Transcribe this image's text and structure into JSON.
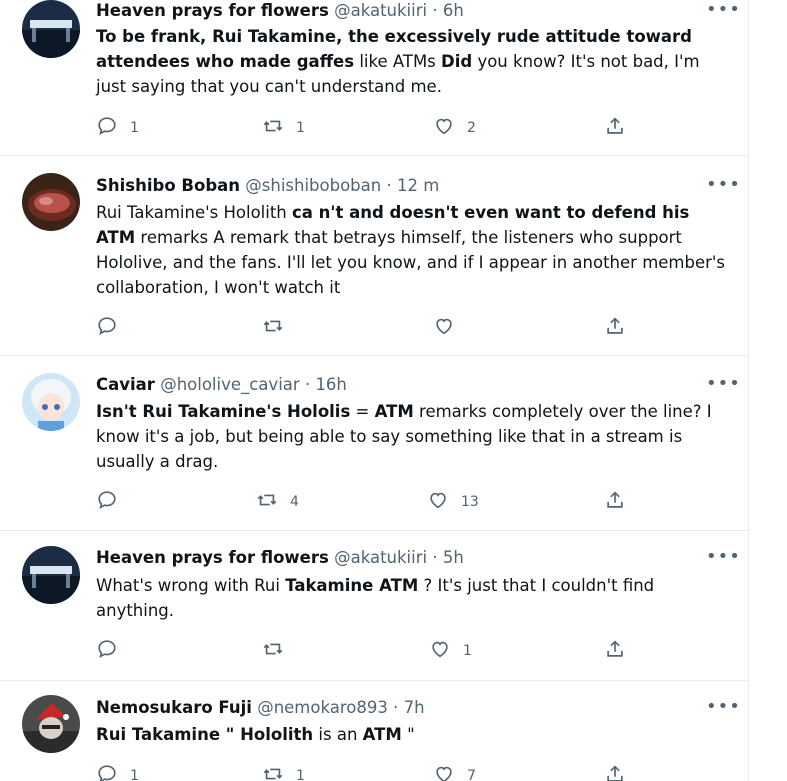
{
  "colors": {
    "text": "#0f1419",
    "muted": "#536471",
    "divider": "#e6ecf0"
  },
  "tweets": [
    {
      "name": "Heaven prays for flowers",
      "handle": "@akatukiiri",
      "time": "6h",
      "avatar": "gate-night-avatar",
      "text_parts": [
        {
          "t": "To be frank, Rui Takamine, the excessively rude attitude toward attendees who made gaffes",
          "b": true
        },
        {
          "t": " like ATMs ",
          "b": false
        },
        {
          "t": "Did",
          "b": true
        },
        {
          "t": " you know? It's not bad, I'm just saying that you can't understand me.",
          "b": false
        }
      ],
      "replies": "1",
      "retweets": "1",
      "likes": "2"
    },
    {
      "name": "Shishibo Boban",
      "handle": "@shishiboboban",
      "time": "12 m",
      "avatar": "steak-avatar",
      "text_parts": [
        {
          "t": "Rui Takamine's Hololith ",
          "b": false
        },
        {
          "t": "ca n't and doesn't even want to defend his ATM",
          "b": true
        },
        {
          "t": " remarks A remark that betrays himself, the listeners who support Hololive, and the fans. I'll let you know, and if I appear in another member's collaboration, I won't watch it",
          "b": false
        }
      ],
      "replies": "",
      "retweets": "",
      "likes": ""
    },
    {
      "name": "Caviar",
      "handle": "@hololive_caviar",
      "time": "16h",
      "avatar": "anime-girl-avatar",
      "text_parts": [
        {
          "t": "Isn't Rui Takamine's Hololis",
          "b": true
        },
        {
          "t": " = ",
          "b": false
        },
        {
          "t": "ATM",
          "b": true
        },
        {
          "t": " remarks completely over the line? I know it's a job, but being able to say something like that in a stream is usually a drag.",
          "b": false
        }
      ],
      "replies": "",
      "retweets": "4",
      "likes": "13"
    },
    {
      "name": "Heaven prays for flowers",
      "handle": "@akatukiiri",
      "time": "5h",
      "avatar": "gate-night-avatar",
      "text_parts": [
        {
          "t": "What's wrong with Rui ",
          "b": false
        },
        {
          "t": "Takamine ATM",
          "b": true
        },
        {
          "t": " ? It's just that I couldn't find anything.",
          "b": false
        }
      ],
      "replies": "",
      "retweets": "",
      "likes": "1"
    },
    {
      "name": "Nemosukaro Fuji",
      "handle": "@nemokaro893",
      "time": "7h",
      "avatar": "santa-figure-avatar",
      "text_parts": [
        {
          "t": "Rui Takamine \" ",
          "b": true
        },
        {
          "t": "Hololith",
          "b": true
        },
        {
          "t": " is an ",
          "b": false
        },
        {
          "t": "ATM",
          "b": true
        },
        {
          "t": " \"",
          "b": false
        }
      ],
      "replies": "1",
      "retweets": "1",
      "likes": "7"
    }
  ],
  "icons": {
    "reply": "reply-icon",
    "retweet": "retweet-icon",
    "like": "like-icon",
    "share": "share-icon",
    "more": "more-options-icon"
  },
  "more_glyph": "•••"
}
